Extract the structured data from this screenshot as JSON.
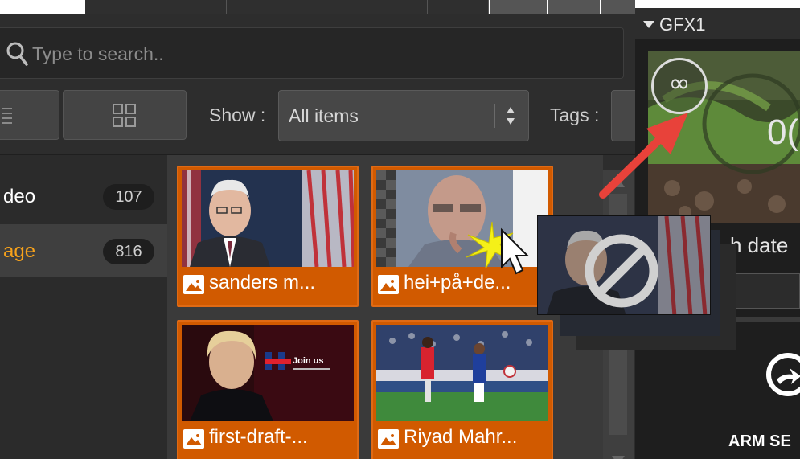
{
  "gfx_panel": {
    "title": "GFX1",
    "loop_icon": "infinity-loop-icon",
    "timer_text": "0(",
    "search_dates_label": "h date",
    "arm_label": "ARM SE",
    "arm_icon": "arm-circle-icon"
  },
  "search": {
    "placeholder": "Type to search..",
    "icon": "search-icon"
  },
  "toolbar": {
    "show_label": "Show :",
    "show_value": "All items",
    "tags_label": "Tags :",
    "list_view_icon": "list-view-icon",
    "grid_view_icon": "grid-view-icon"
  },
  "categories": [
    {
      "label": "deo",
      "count": "107",
      "color": "#ffffff"
    },
    {
      "label": "age",
      "count": "816",
      "color": "#f7a21b"
    }
  ],
  "media_items": [
    {
      "caption": "sanders m...",
      "icon": "image-icon"
    },
    {
      "caption": "hei+på+de...",
      "icon": "image-icon"
    },
    {
      "caption": "first-draft-...",
      "icon": "image-icon"
    },
    {
      "caption": "Riyad Mahr...",
      "icon": "image-icon"
    }
  ],
  "thumb_overlay_text": {
    "join_us": "Join us"
  },
  "colors": {
    "accent_orange": "#d15a00",
    "selected_category": "#f7a21b",
    "panel_bg": "#2d2d2d",
    "annotation_arrow": "#e8423a"
  },
  "drag_feedback": {
    "icon": "no-drop-icon"
  }
}
